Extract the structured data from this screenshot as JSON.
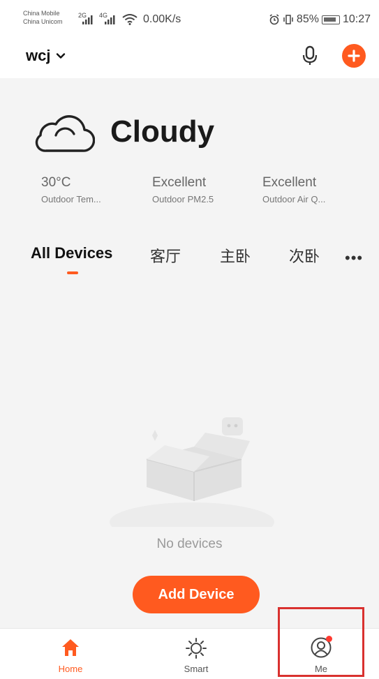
{
  "status_bar": {
    "carrier_1": "China Mobile",
    "carrier_2": "China Unicom",
    "sig_1": "2G",
    "sig_2": "4G",
    "network_speed": "0.00K/s",
    "battery": "85%",
    "time": "10:27"
  },
  "header": {
    "home_name": "wcj"
  },
  "weather": {
    "condition": "Cloudy",
    "metrics": [
      {
        "value": "30°C",
        "label": "Outdoor Tem..."
      },
      {
        "value": "Excellent",
        "label": "Outdoor PM2.5"
      },
      {
        "value": "Excellent",
        "label": "Outdoor Air Q..."
      }
    ]
  },
  "tabs": [
    {
      "label": "All Devices",
      "active": true
    },
    {
      "label": "客厅"
    },
    {
      "label": "主卧"
    },
    {
      "label": "次卧"
    }
  ],
  "more_label": "•••",
  "empty_state": {
    "message": "No devices",
    "button": "Add Device"
  },
  "bottom_nav": [
    {
      "label": "Home",
      "icon": "home-icon",
      "active": true
    },
    {
      "label": "Smart",
      "icon": "sun-icon"
    },
    {
      "label": "Me",
      "icon": "user-icon",
      "badge": true
    }
  ],
  "colors": {
    "accent": "#ff5a1f",
    "highlight": "#d9312f"
  }
}
